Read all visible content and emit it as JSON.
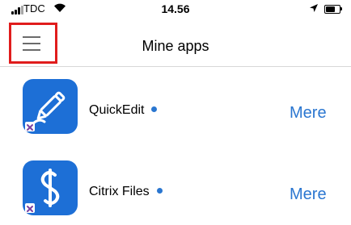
{
  "status_bar": {
    "carrier": "TDC",
    "time": "14.56",
    "icons": [
      "signal-icon",
      "wifi-icon",
      "location-arrow-icon",
      "battery-icon"
    ]
  },
  "nav": {
    "title": "Mine apps",
    "menu_icon": "hamburger-menu-icon",
    "highlight_color": "#e01c1c"
  },
  "apps": [
    {
      "name": "QuickEdit",
      "more_label": "Mere",
      "icon": "pen-app-icon",
      "status_dot_color": "#2a76d0",
      "badge_icon": "citrix-badge-icon"
    },
    {
      "name": "Citrix Files",
      "more_label": "Mere",
      "icon": "citrix-files-app-icon",
      "status_dot_color": "#2a76d0",
      "badge_icon": "citrix-badge-icon"
    }
  ],
  "colors": {
    "accent": "#2a76d0",
    "app_icon_bg": "#1d6fd6",
    "divider": "#d8d8d8"
  }
}
